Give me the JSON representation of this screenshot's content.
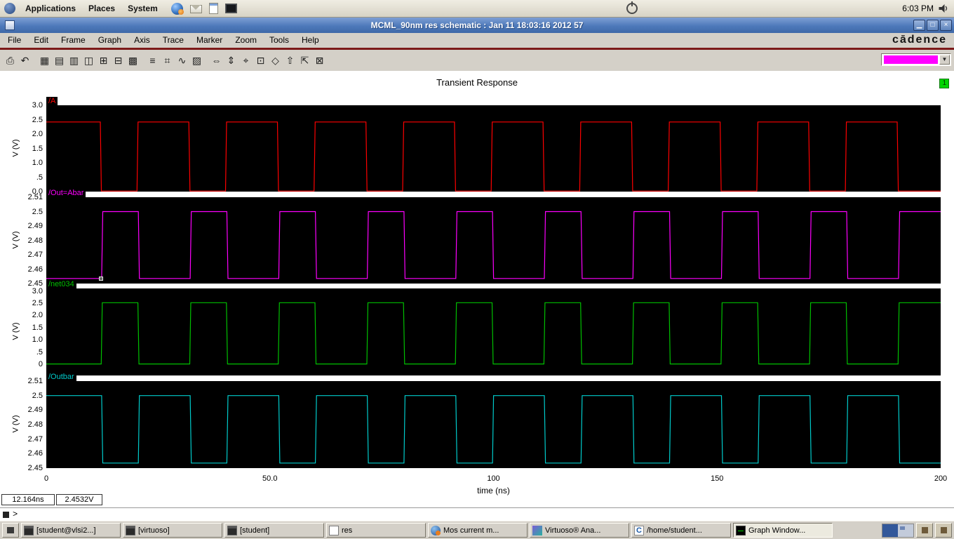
{
  "desktop": {
    "menus": [
      "Applications",
      "Places",
      "System"
    ],
    "launchers": [
      "web-browser",
      "email",
      "document",
      "terminal"
    ],
    "clock": "6:03 PM"
  },
  "window": {
    "title": "MCML_90nm res schematic : Jan 11 18:03:16 2012 57",
    "controls": [
      {
        "name": "minimize",
        "glyph": "▁"
      },
      {
        "name": "maximize",
        "glyph": "□"
      },
      {
        "name": "close",
        "glyph": "×"
      }
    ],
    "menu_items": [
      "File",
      "Edit",
      "Frame",
      "Graph",
      "Axis",
      "Trace",
      "Marker",
      "Zoom",
      "Tools",
      "Help"
    ],
    "brand": "cādence"
  },
  "toolbar": {
    "trace_color": "#ff00ff",
    "icons": [
      {
        "name": "print",
        "glyph": "⎙"
      },
      {
        "name": "undo",
        "glyph": "↶"
      },
      {
        "name": "axis-grid",
        "glyph": "▦"
      },
      {
        "name": "strip-chart",
        "glyph": "▤"
      },
      {
        "name": "overlay-graph",
        "glyph": "▥"
      },
      {
        "name": "split-subwindow",
        "glyph": "◫"
      },
      {
        "name": "new-subwindow",
        "glyph": "⊞"
      },
      {
        "name": "delete-subwindow",
        "glyph": "⊟"
      },
      {
        "name": "graph-layout",
        "glyph": "▩"
      },
      {
        "name": "trace-labels",
        "glyph": "≡"
      },
      {
        "name": "snap-grid",
        "glyph": "⌗"
      },
      {
        "name": "waveform-tool",
        "glyph": "∿"
      },
      {
        "name": "data-table",
        "glyph": "▨"
      },
      {
        "name": "zoom-x",
        "glyph": "⇔"
      },
      {
        "name": "zoom-y",
        "glyph": "⇕"
      },
      {
        "name": "crosshair",
        "glyph": "⌖"
      },
      {
        "name": "zoom-box",
        "glyph": "⊡"
      },
      {
        "name": "marker-diamond",
        "glyph": "◇"
      },
      {
        "name": "pan-up",
        "glyph": "⇧"
      },
      {
        "name": "fit-view",
        "glyph": "⇱"
      },
      {
        "name": "select-region",
        "glyph": "⊠"
      }
    ]
  },
  "graph": {
    "title": "Transient Response",
    "subwindow_badge": "1",
    "xlabel": "time (ns)",
    "x_ticks": [
      "0",
      "50.0",
      "100",
      "150",
      "200"
    ],
    "x_range_ns": [
      0,
      200
    ]
  },
  "chart_data": [
    {
      "type": "line",
      "waveform": "square",
      "name": "/A",
      "color": "#ff0000",
      "y_axis_label": "V (V)",
      "ylim": [
        0,
        3.0
      ],
      "yticks": [
        [
          3.0,
          "3.0"
        ],
        [
          2.5,
          "2.5"
        ],
        [
          2.0,
          "2.0"
        ],
        [
          1.5,
          "1.5"
        ],
        [
          1.0,
          "1.0"
        ],
        [
          0.5,
          ".5"
        ],
        [
          0.0,
          "0.0"
        ]
      ],
      "x_range_ns": [
        0,
        200
      ],
      "initial_level": "high",
      "high_v": 2.42,
      "low_v": 0.02,
      "edge_times_ns": [
        12.2,
        20.4,
        32.0,
        40.2,
        51.8,
        60.0,
        71.6,
        79.8,
        91.4,
        99.6,
        111.2,
        119.4,
        131.0,
        139.2,
        150.8,
        159.0,
        170.6,
        178.8,
        190.4
      ]
    },
    {
      "type": "line",
      "waveform": "square",
      "name": "/Out=Abar",
      "color": "#ff00ff",
      "y_axis_label": "V (V)",
      "ylim": [
        2.45,
        2.51
      ],
      "yticks": [
        [
          2.51,
          "2.51"
        ],
        [
          2.5,
          "2.5"
        ],
        [
          2.49,
          "2.49"
        ],
        [
          2.48,
          "2.48"
        ],
        [
          2.47,
          "2.47"
        ],
        [
          2.46,
          "2.46"
        ],
        [
          2.45,
          "2.45"
        ]
      ],
      "x_range_ns": [
        0,
        200
      ],
      "initial_level": "low",
      "high_v": 2.5,
      "low_v": 2.4535,
      "edge_times_ns": [
        12.5,
        20.7,
        32.3,
        40.5,
        52.1,
        60.3,
        71.9,
        80.1,
        91.7,
        99.9,
        111.5,
        119.7,
        131.3,
        139.5,
        151.1,
        159.3,
        170.9,
        179.1,
        190.7
      ]
    },
    {
      "type": "line",
      "waveform": "square",
      "name": "/net034",
      "color": "#00c000",
      "y_axis_label": "V (V)",
      "ylim": [
        -0.45,
        3.1
      ],
      "yticks": [
        [
          3.0,
          "3.0"
        ],
        [
          2.5,
          "2.5"
        ],
        [
          2.0,
          "2.0"
        ],
        [
          1.5,
          "1.5"
        ],
        [
          1.0,
          "1.0"
        ],
        [
          0.5,
          ".5"
        ],
        [
          0.0,
          "0"
        ]
      ],
      "x_range_ns": [
        0,
        200
      ],
      "initial_level": "low",
      "high_v": 2.52,
      "low_v": 0.02,
      "edge_times_ns": [
        12.4,
        20.6,
        32.2,
        40.4,
        52.0,
        60.2,
        71.8,
        80.0,
        91.6,
        99.8,
        111.4,
        119.6,
        131.2,
        139.4,
        151.0,
        159.2,
        170.8,
        179.0,
        190.6
      ]
    },
    {
      "type": "line",
      "waveform": "square",
      "name": "/Outbar",
      "color": "#00cccc",
      "y_axis_label": "V (V)",
      "ylim": [
        2.45,
        2.51
      ],
      "yticks": [
        [
          2.51,
          "2.51"
        ],
        [
          2.5,
          "2.5"
        ],
        [
          2.49,
          "2.49"
        ],
        [
          2.48,
          "2.48"
        ],
        [
          2.47,
          "2.47"
        ],
        [
          2.46,
          "2.46"
        ],
        [
          2.45,
          "2.45"
        ]
      ],
      "x_range_ns": [
        0,
        200
      ],
      "initial_level": "high",
      "high_v": 2.5,
      "low_v": 2.4535,
      "edge_times_ns": [
        12.5,
        20.7,
        32.3,
        40.5,
        52.1,
        60.3,
        71.9,
        80.1,
        91.7,
        99.9,
        111.5,
        119.7,
        131.3,
        139.5,
        151.1,
        159.3,
        170.9,
        179.1,
        190.7
      ]
    }
  ],
  "marker_readout": {
    "time": "12.164ns",
    "value": "2.4532V",
    "time_ns": 12.164,
    "value_v": 2.4532,
    "panel_index": 1
  },
  "command_prompt": ">",
  "taskbar": {
    "buttons": [
      {
        "label": "[student@vlsi2...]",
        "icon": "terminal",
        "active": false
      },
      {
        "label": "[virtuoso]",
        "icon": "terminal",
        "active": false
      },
      {
        "label": "[student]",
        "icon": "terminal",
        "active": false
      },
      {
        "label": "res",
        "icon": "window",
        "active": false
      },
      {
        "label": "Mos current m...",
        "icon": "browser",
        "active": false
      },
      {
        "label": "Virtuoso® Ana...",
        "icon": "virtuoso",
        "active": false
      },
      {
        "label": "/home/student...",
        "icon": "cadence",
        "active": false
      },
      {
        "label": "Graph Window...",
        "icon": "graph",
        "active": true
      }
    ]
  }
}
